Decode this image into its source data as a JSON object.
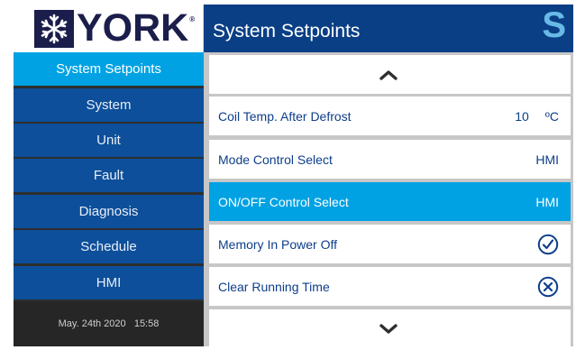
{
  "brand": {
    "name": "YORK",
    "registered": "®"
  },
  "header": {
    "title": "System Setpoints",
    "badge": "S"
  },
  "sidebar": {
    "items": [
      {
        "label": "System Setpoints",
        "active": true
      },
      {
        "label": "System",
        "active": false
      },
      {
        "label": "Unit",
        "active": false
      },
      {
        "label": "Fault",
        "active": false
      },
      {
        "label": "Diagnosis",
        "active": false
      },
      {
        "label": "Schedule",
        "active": false
      },
      {
        "label": "HMI",
        "active": false
      }
    ],
    "datetime": "May. 24th 2020   15:58"
  },
  "settings": {
    "rows": [
      {
        "label": "Coil Temp. After Defrost",
        "value": "10",
        "unit": "ºC"
      },
      {
        "label": "Mode Control Select",
        "value": "HMI"
      },
      {
        "label": "ON/OFF Control Select",
        "value": "HMI",
        "active": true
      },
      {
        "label": "Memory In Power Off",
        "icon": "check-circle-icon"
      },
      {
        "label": "Clear Running Time",
        "icon": "x-circle-icon"
      }
    ],
    "scroll_up_icon": "chevron-up-icon",
    "scroll_down_icon": "chevron-down-icon"
  },
  "colors": {
    "header_bg": "#0a3f86",
    "nav_bg": "#0d4f9a",
    "active_bg": "#00a2e3",
    "row_text": "#0d3e8a",
    "content_bg": "#c7c7c7",
    "badge": "#69b9e6"
  }
}
